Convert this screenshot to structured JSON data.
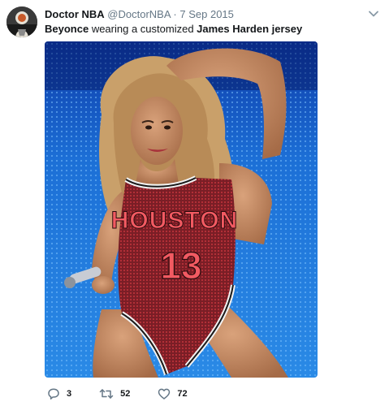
{
  "tweet": {
    "author": {
      "display_name": "Doctor NBA",
      "handle": "@DoctorNBA",
      "avatar_icon": "avatar-icon"
    },
    "separator": "·",
    "timestamp": "7 Sep 2015",
    "text": {
      "part1": "Beyonce",
      "part2": " wearing a customized ",
      "part3": "James Harden jersey"
    },
    "media": {
      "jersey_city": "HOUSTON",
      "jersey_number": "13"
    },
    "actions": {
      "reply_count": "3",
      "retweet_count": "52",
      "like_count": "72"
    }
  },
  "colors": {
    "muted_text": "#657786",
    "jersey_red": "#c4343c",
    "stage_blue": "#1a6fd0"
  }
}
